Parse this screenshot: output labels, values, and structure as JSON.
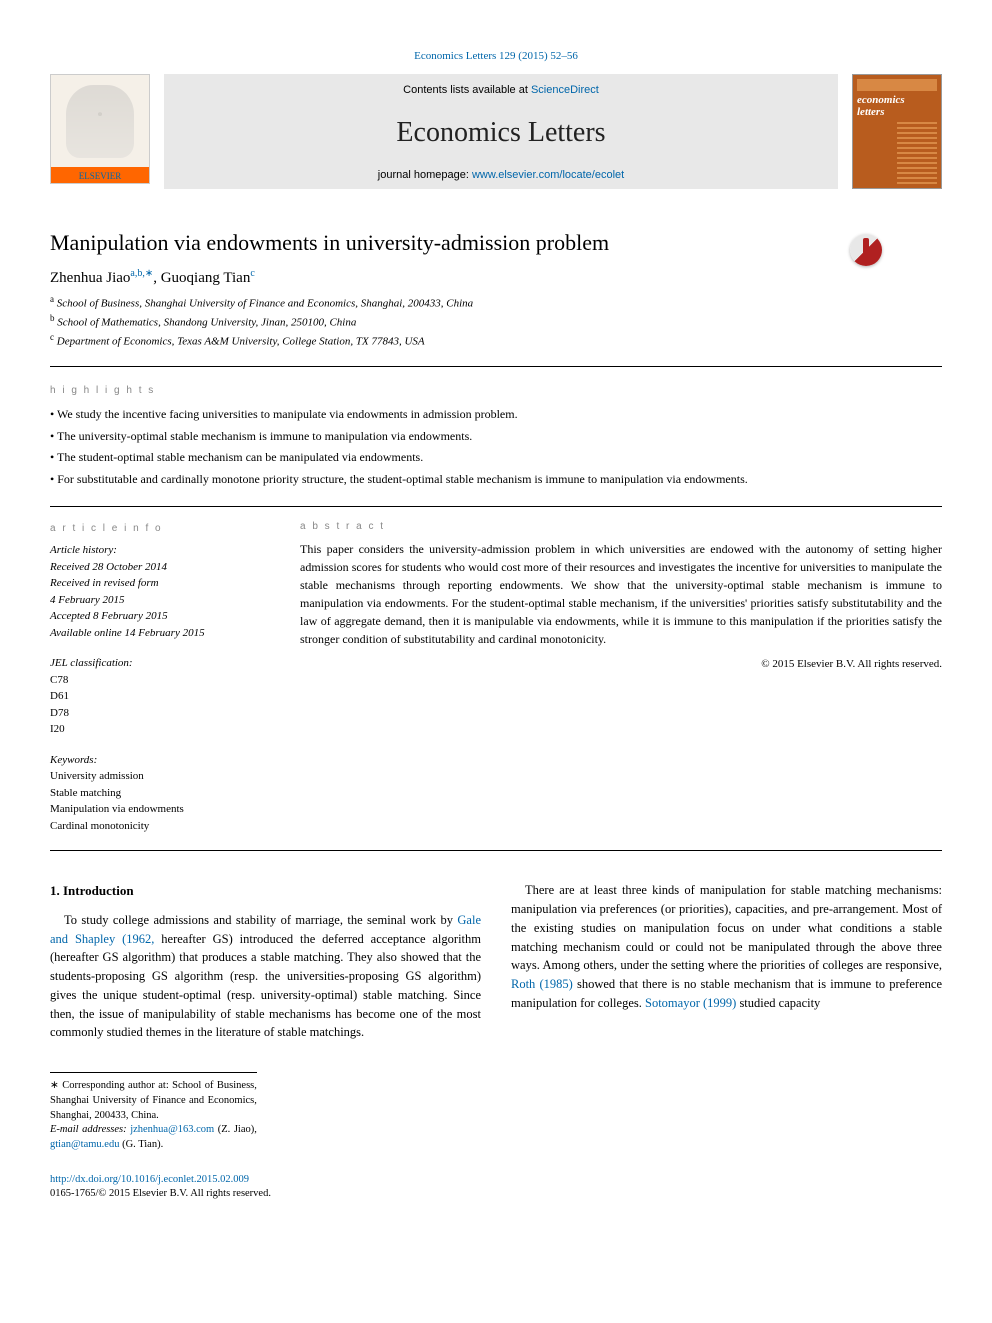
{
  "citation": "Economics Letters 129 (2015) 52–56",
  "banner": {
    "contents_prefix": "Contents lists available at ",
    "contents_link": "ScienceDirect",
    "journal_title": "Economics Letters",
    "homepage_prefix": "journal homepage: ",
    "homepage_link": "www.elsevier.com/locate/ecolet",
    "elsevier_label": "ELSEVIER",
    "cover_title_line1": "economics",
    "cover_title_line2": "letters"
  },
  "paper": {
    "title": "Manipulation via endowments in university-admission problem",
    "authors": [
      {
        "name": "Zhenhua Jiao",
        "marks": "a,b,∗"
      },
      {
        "name": "Guoqiang Tian",
        "marks": "c"
      }
    ],
    "affiliations": [
      {
        "mark": "a",
        "text": "School of Business, Shanghai University of Finance and Economics, Shanghai, 200433, China"
      },
      {
        "mark": "b",
        "text": "School of Mathematics, Shandong University, Jinan, 250100, China"
      },
      {
        "mark": "c",
        "text": "Department of Economics, Texas A&M University, College Station, TX 77843, USA"
      }
    ]
  },
  "highlights": {
    "label": "h i g h l i g h t s",
    "items": [
      "We study the incentive facing universities to manipulate via endowments in admission problem.",
      "The university-optimal stable mechanism is immune to manipulation via endowments.",
      "The student-optimal stable mechanism can be manipulated via endowments.",
      "For substitutable and cardinally monotone priority structure, the student-optimal stable mechanism is immune to manipulation via endowments."
    ]
  },
  "article_info": {
    "label": "a r t i c l e    i n f o",
    "history": [
      "Article history:",
      "Received 28 October 2014",
      "Received in revised form",
      "4 February 2015",
      "Accepted 8 February 2015",
      "Available online 14 February 2015"
    ],
    "jel_head": "JEL classification:",
    "jel_codes": [
      "C78",
      "D61",
      "D78",
      "I20"
    ],
    "kw_head": "Keywords:",
    "keywords": [
      "University admission",
      "Stable matching",
      "Manipulation via endowments",
      "Cardinal monotonicity"
    ]
  },
  "abstract": {
    "label": "a b s t r a c t",
    "text": "This paper considers the university-admission problem in which universities are endowed with the autonomy of setting higher admission scores for students who would cost more of their resources and investigates the incentive for universities to manipulate the stable mechanisms through reporting endowments. We show that the university-optimal stable mechanism is immune to manipulation via endowments. For the student-optimal stable mechanism, if the universities' priorities satisfy substitutability and the law of aggregate demand, then it is manipulable via endowments, while it is immune to this manipulation if the priorities satisfy the stronger condition of substitutability and cardinal monotonicity.",
    "copyright": "© 2015 Elsevier B.V. All rights reserved."
  },
  "sections": {
    "intro_head": "1. Introduction",
    "col1_p1": "To study college admissions and stability of marriage, the seminal work by ",
    "gale_shapley": "Gale and Shapley (1962,",
    "col1_p1b": " hereafter GS) introduced the deferred acceptance algorithm (hereafter GS algorithm) that produces a stable matching. They also showed that the students-proposing GS algorithm (resp. the universities-proposing GS algorithm) gives the unique student-optimal (resp. university-optimal) stable matching. Since then, the issue of manipulability of stable mechanisms has become one of the most commonly studied themes in the literature of stable matchings.",
    "col2_p1": "There are at least three kinds of manipulation for stable matching mechanisms: manipulation via preferences (or priorities), capacities, and pre-arrangement. Most of the existing studies on manipulation focus on under what conditions a stable matching mechanism could or could not be manipulated through the above three ways. Among others, under the setting where the priorities of colleges are responsive, ",
    "roth": "Roth (1985)",
    "col2_p1b": " showed that there is no stable mechanism that is immune to preference manipulation for colleges. ",
    "sotomayor": "Sotomayor (1999)",
    "col2_p1c": " studied capacity"
  },
  "footnotes": {
    "corr": "Corresponding author at: School of Business, Shanghai University of Finance and Economics, Shanghai, 200433, China.",
    "email_label": "E-mail addresses:",
    "email1": "jzhenhua@163.com",
    "email1_who": " (Z. Jiao), ",
    "email2": "gtian@tamu.edu",
    "email2_who": " (G. Tian)."
  },
  "doi": {
    "link": "http://dx.doi.org/10.1016/j.econlet.2015.02.009",
    "issn": "0165-1765/© 2015 Elsevier B.V. All rights reserved."
  },
  "chart_data": {
    "type": "table",
    "note": "article-info block values",
    "jel": [
      "C78",
      "D61",
      "D78",
      "I20"
    ],
    "keywords": [
      "University admission",
      "Stable matching",
      "Manipulation via endowments",
      "Cardinal monotonicity"
    ]
  }
}
